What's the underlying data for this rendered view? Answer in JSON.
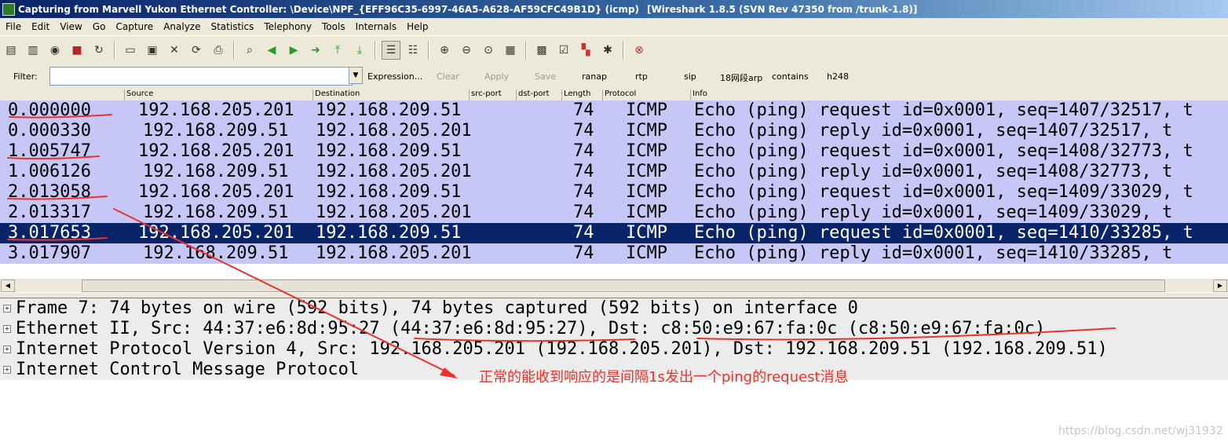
{
  "window": {
    "title_left": "Capturing from Marvell Yukon Ethernet Controller: \\Device\\NPF_{EFF96C35-6997-46A5-A628-AF59CFC49B1D} (icmp)",
    "title_right": "[Wireshark 1.8.5 (SVN Rev 47350 from /trunk-1.8)]"
  },
  "menu": [
    "File",
    "Edit",
    "View",
    "Go",
    "Capture",
    "Analyze",
    "Statistics",
    "Telephony",
    "Tools",
    "Internals",
    "Help"
  ],
  "filter": {
    "label": "Filter:",
    "value": "",
    "expression": "Expression...",
    "clear": "Clear",
    "apply": "Apply",
    "save": "Save",
    "buttons": [
      "ranap",
      "rtp",
      "sip",
      "18网段arp",
      "contains",
      "h248"
    ]
  },
  "columns": [
    "Source",
    "Destination",
    "src-port",
    "dst-port",
    "Length",
    "Protocol",
    "Info"
  ],
  "packets": [
    {
      "time": "0.000000",
      "src": "192.168.205.201",
      "dst": "192.168.209.51",
      "len": "74",
      "proto": "ICMP",
      "info": "Echo (ping) request  id=0x0001, seq=1407/32517, t"
    },
    {
      "time": "0.000330",
      "src": "192.168.209.51",
      "dst": "192.168.205.201",
      "len": "74",
      "proto": "ICMP",
      "info": "Echo (ping) reply    id=0x0001, seq=1407/32517, t"
    },
    {
      "time": "1.005747",
      "src": "192.168.205.201",
      "dst": "192.168.209.51",
      "len": "74",
      "proto": "ICMP",
      "info": "Echo (ping) request  id=0x0001, seq=1408/32773, t"
    },
    {
      "time": "1.006126",
      "src": "192.168.209.51",
      "dst": "192.168.205.201",
      "len": "74",
      "proto": "ICMP",
      "info": "Echo (ping) reply    id=0x0001, seq=1408/32773, t"
    },
    {
      "time": "2.013058",
      "src": "192.168.205.201",
      "dst": "192.168.209.51",
      "len": "74",
      "proto": "ICMP",
      "info": "Echo (ping) request  id=0x0001, seq=1409/33029, t"
    },
    {
      "time": "2.013317",
      "src": "192.168.209.51",
      "dst": "192.168.205.201",
      "len": "74",
      "proto": "ICMP",
      "info": "Echo (ping) reply    id=0x0001, seq=1409/33029, t"
    },
    {
      "time": "3.017653",
      "src": "192.168.205.201",
      "dst": "192.168.209.51",
      "len": "74",
      "proto": "ICMP",
      "info": "Echo (ping) request  id=0x0001, seq=1410/33285, t"
    },
    {
      "time": "3.017907",
      "src": "192.168.209.51",
      "dst": "192.168.205.201",
      "len": "74",
      "proto": "ICMP",
      "info": "Echo (ping) reply    id=0x0001, seq=1410/33285, t"
    }
  ],
  "selected_packet_index": 6,
  "details": [
    "Frame 7: 74 bytes on wire (592 bits), 74 bytes captured (592 bits) on interface 0",
    "Ethernet II, Src: 44:37:e6:8d:95:27 (44:37:e6:8d:95:27), Dst: c8:50:e9:67:fa:0c (c8:50:e9:67:fa:0c)",
    "Internet Protocol Version 4, Src: 192.168.205.201 (192.168.205.201), Dst: 192.168.209.51 (192.168.209.51)",
    "Internet Control Message Protocol"
  ],
  "annotation": "正常的能收到响应的是间隔1s发出一个ping的request消息",
  "watermark": "https://blog.csdn.net/wj31932",
  "colors": {
    "row_bg": "#c6c7f7",
    "row_selected_bg": "#0a246a",
    "annotation": "#e8342c"
  },
  "toolbar_icons": [
    "interfaces-icon",
    "options-icon",
    "start-icon",
    "stop-icon",
    "restart-icon",
    "open-icon",
    "save-icon",
    "close-icon",
    "reload-icon",
    "print-icon",
    "find-icon",
    "back-icon",
    "forward-icon",
    "goto-icon",
    "first-icon",
    "last-icon",
    "colorize-icon",
    "autoscroll-icon",
    "zoom-in-icon",
    "zoom-out-icon",
    "normal-size-icon",
    "resize-columns-icon",
    "capture-filters-icon",
    "display-filters-icon",
    "coloring-rules-icon",
    "preferences-icon",
    "help-icon"
  ]
}
